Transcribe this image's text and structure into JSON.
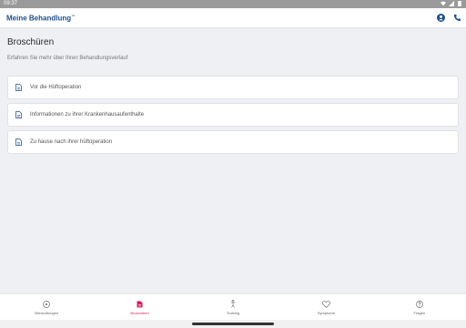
{
  "status_bar": {
    "time": "09:37"
  },
  "header": {
    "brand": "Meine Behandlung",
    "brand_mark": "™"
  },
  "page": {
    "title": "Broschüren",
    "subtitle": "Erfahren Sie mehr über Ihren Behandlungsverlauf"
  },
  "brochures": [
    {
      "label": "Vor die Hüftoperation",
      "icon": "document-icon"
    },
    {
      "label": "Informationen zu ihrer Krankenhausaufenthalte",
      "icon": "document-icon"
    },
    {
      "label": "Zu hause nach ihrer hüftoperation",
      "icon": "document-icon"
    }
  ],
  "bottom_nav": [
    {
      "label": "Behandlungen",
      "icon": "play-circle-icon",
      "active": false
    },
    {
      "label": "Broschüren",
      "icon": "document-icon",
      "active": true
    },
    {
      "label": "Training",
      "icon": "exercise-icon",
      "active": false
    },
    {
      "label": "Symptome",
      "icon": "heart-icon",
      "active": false
    },
    {
      "label": "Fragen",
      "icon": "help-circle-icon",
      "active": false
    }
  ],
  "colors": {
    "brand": "#1f4f8f",
    "accent_active": "#d81b60",
    "background": "#eef0f4"
  }
}
